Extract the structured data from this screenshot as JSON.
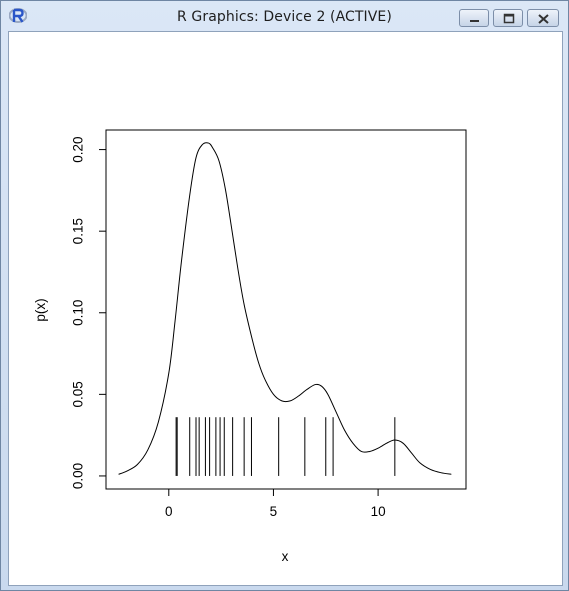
{
  "window": {
    "title": "R Graphics: Device 2 (ACTIVE)",
    "app_icon": "r-logo-icon",
    "buttons": {
      "minimize_icon": "minimize-icon",
      "maximize_icon": "maximize-icon",
      "close_icon": "close-icon"
    }
  },
  "chart_data": {
    "type": "line",
    "title": "",
    "xlabel": "x",
    "ylabel": "p(x)",
    "xlim": [
      -3.0,
      14.2
    ],
    "ylim": [
      -0.008,
      0.212
    ],
    "x_ticks": [
      0,
      5,
      10
    ],
    "x_tick_labels": [
      "0",
      "5",
      "10"
    ],
    "y_ticks": [
      0.0,
      0.05,
      0.1,
      0.15,
      0.2
    ],
    "y_tick_labels": [
      "0.00",
      "0.05",
      "0.10",
      "0.15",
      "0.20"
    ],
    "series": [
      {
        "x": [
          -2.4,
          -2.0,
          -1.5,
          -1.0,
          -0.5,
          0.0,
          0.3,
          0.6,
          1.0,
          1.3,
          1.6,
          1.9,
          2.1,
          2.4,
          2.7,
          3.0,
          3.3,
          3.6,
          4.0,
          4.3,
          4.6,
          5.0,
          5.4,
          5.8,
          6.2,
          6.6,
          7.0,
          7.3,
          7.6,
          8.0,
          8.4,
          8.8,
          9.2,
          9.6,
          10.0,
          10.4,
          10.8,
          11.2,
          11.6,
          12.0,
          12.5,
          13.0,
          13.5
        ],
        "y": [
          0.001,
          0.003,
          0.007,
          0.016,
          0.033,
          0.063,
          0.095,
          0.131,
          0.172,
          0.195,
          0.203,
          0.204,
          0.201,
          0.193,
          0.176,
          0.152,
          0.127,
          0.105,
          0.083,
          0.069,
          0.059,
          0.05,
          0.046,
          0.046,
          0.049,
          0.053,
          0.056,
          0.055,
          0.05,
          0.039,
          0.028,
          0.02,
          0.015,
          0.015,
          0.017,
          0.02,
          0.022,
          0.02,
          0.014,
          0.008,
          0.004,
          0.002,
          0.001
        ]
      }
    ],
    "rug": {
      "x": [
        0.35,
        0.4,
        1.0,
        1.3,
        1.45,
        1.75,
        1.95,
        2.25,
        2.45,
        2.65,
        3.05,
        3.6,
        3.95,
        5.25,
        6.5,
        7.5,
        7.85,
        10.8
      ],
      "height": 0.036
    }
  }
}
